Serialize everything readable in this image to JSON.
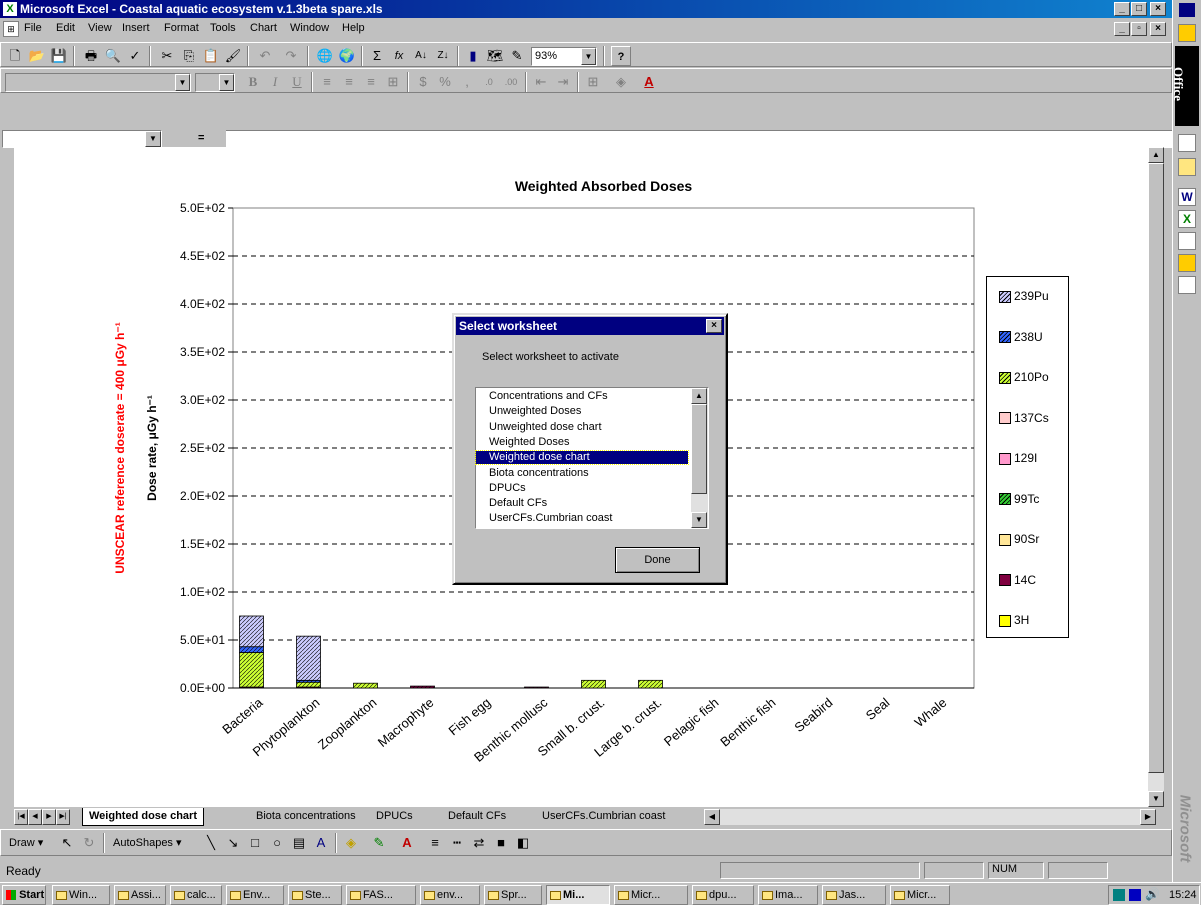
{
  "window": {
    "title": "Microsoft Excel - Coastal aquatic ecosystem v.1.3beta spare.xls",
    "app_icon": "excel-icon",
    "controls": [
      "minimize-icon",
      "maximize-icon",
      "close-icon"
    ]
  },
  "menu": [
    "File",
    "Edit",
    "View",
    "Insert",
    "Format",
    "Tools",
    "Chart",
    "Window",
    "Help"
  ],
  "toolbar": {
    "zoom": "93%",
    "font_name": "",
    "font_size": "",
    "bold": "B",
    "italic": "I",
    "underline": "U",
    "percent": "%",
    "comma": ",",
    "sum_symbol": "Σ",
    "function_symbol": "fx",
    "help_symbol": "?"
  },
  "formula_bar": {
    "name_box": "",
    "equals": "="
  },
  "chart_data": {
    "type": "bar",
    "stacked": true,
    "title": "Weighted Absorbed Doses",
    "xlabel": "",
    "ylabel": "Dose rate, μGy h⁻¹",
    "reference_label": "UNSCEAR reference doserate = 400 μGy h⁻¹",
    "ylim": [
      0,
      500
    ],
    "y_ticks": [
      "0.0E+00",
      "5.0E+01",
      "1.0E+02",
      "1.5E+02",
      "2.0E+02",
      "2.5E+02",
      "3.0E+02",
      "3.5E+02",
      "4.0E+02",
      "4.5E+02",
      "5.0E+02"
    ],
    "grid": "dashed horizontal",
    "legend_position": "right",
    "categories": [
      "Bacteria",
      "Phytoplankton",
      "Zooplankton",
      "Macrophyte",
      "Fish egg",
      "Benthic mollusc",
      "Small b. crust.",
      "Large b. crust.",
      "Pelagic fish",
      "Benthic fish",
      "Seabird",
      "Seal",
      "Whale"
    ],
    "series": [
      {
        "name": "3H",
        "color": "#ffff00",
        "values": [
          0,
          0,
          0,
          0,
          0,
          0,
          0,
          0,
          0,
          0,
          0,
          0,
          0
        ]
      },
      {
        "name": "14C",
        "color": "#800040",
        "values": [
          1,
          1,
          0,
          2,
          0,
          1,
          0,
          0,
          0,
          0,
          0,
          0,
          0
        ]
      },
      {
        "name": "90Sr",
        "color": "#ffe699",
        "values": [
          0,
          0,
          0,
          0,
          0,
          0,
          0,
          0,
          0,
          0,
          0,
          0,
          0
        ]
      },
      {
        "name": "99Tc",
        "color": "#33cc33",
        "values": [
          0,
          0,
          0,
          0,
          0,
          0,
          0,
          0,
          0,
          0,
          0,
          0,
          0
        ]
      },
      {
        "name": "129I",
        "color": "#ff99cc",
        "values": [
          0,
          0,
          0,
          0,
          0,
          0,
          0,
          0,
          0,
          0,
          0,
          0,
          0
        ]
      },
      {
        "name": "137Cs",
        "color": "#ffcccc",
        "values": [
          0,
          0,
          0,
          0,
          0,
          0,
          0,
          0,
          0,
          0,
          0,
          0,
          0
        ]
      },
      {
        "name": "210Po",
        "color": "#ccff33",
        "values": [
          36,
          5,
          5,
          0,
          0,
          0,
          8,
          8,
          0,
          0,
          0,
          0,
          0
        ]
      },
      {
        "name": "238U",
        "color": "#3366ff",
        "values": [
          6,
          2,
          0,
          0,
          0,
          0,
          0,
          0,
          0,
          0,
          0,
          0,
          0
        ]
      },
      {
        "name": "239Pu",
        "color": "#ccccff",
        "values": [
          32,
          46,
          0,
          0,
          0,
          0,
          0,
          0,
          0,
          0,
          0,
          0,
          0
        ]
      }
    ],
    "legend_order": [
      "239Pu",
      "238U",
      "210Po",
      "137Cs",
      "129I",
      "99Tc",
      "90Sr",
      "14C",
      "3H"
    ]
  },
  "dialog": {
    "title": "Select worksheet",
    "prompt": "Select worksheet to activate",
    "items": [
      "Concentrations and CFs",
      "Unweighted Doses",
      "Unweighted dose chart",
      "Weighted Doses",
      "Weighted dose chart",
      "Biota concentrations",
      "DPUCs",
      "Default CFs",
      "UserCFs.Cumbrian coast"
    ],
    "selected": "Weighted dose chart",
    "done_label": "Done"
  },
  "tabs": [
    "Weighted dose chart",
    "Biota concentrations",
    "DPUCs",
    "Default CFs",
    "UserCFs.Cumbrian coast"
  ],
  "draw_toolbar": {
    "draw": "Draw",
    "autoshapes": "AutoShapes"
  },
  "status": {
    "text": "Ready",
    "num": "NUM"
  },
  "taskbar": {
    "start": "Start",
    "tasks": [
      "Win...",
      "Assi...",
      "calc...",
      "Env...",
      "Ste...",
      "FAS...",
      "env...",
      "Spr...",
      "Mi...",
      "Micr...",
      "dpu...",
      "Ima...",
      "Jas...",
      "Micr..."
    ],
    "clock": "15:24"
  },
  "office_bar": {
    "label": "Office",
    "watermark": "Microsoft"
  }
}
